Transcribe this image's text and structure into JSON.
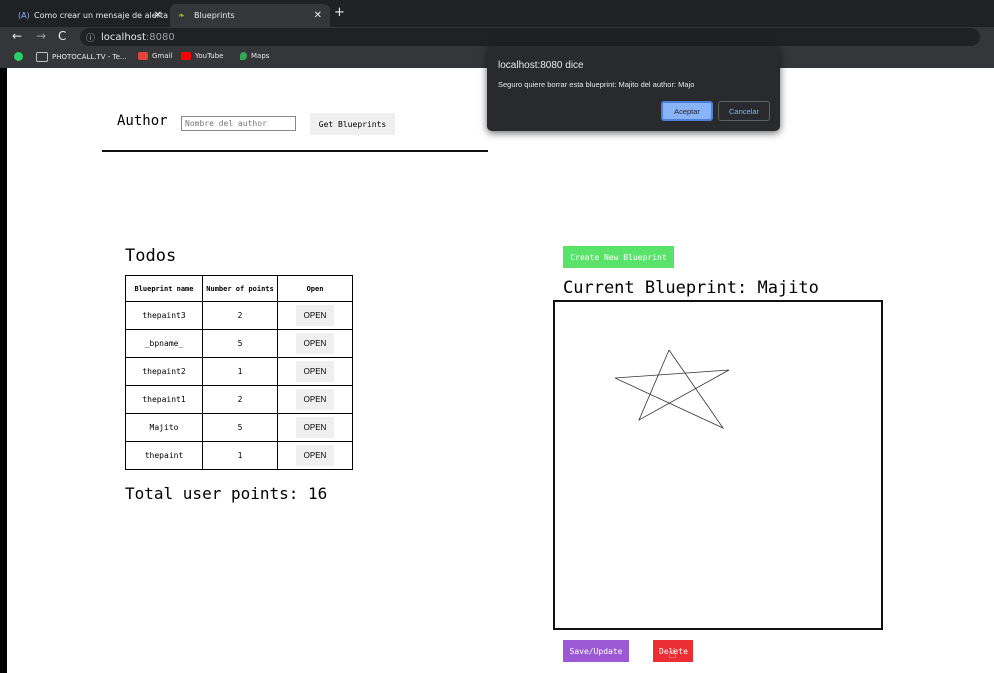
{
  "browser": {
    "tabs": [
      {
        "label": "Como crear un mensaje de alerta",
        "favicon": "(A)",
        "active": false
      },
      {
        "label": "Blueprints",
        "favicon": "leaf",
        "active": true
      }
    ],
    "url_host": "localhost",
    "url_port": ":8080",
    "bookmarks": [
      "PHOTOCALL.TV - Te...",
      "Gmail",
      "YouTube",
      "Maps"
    ]
  },
  "header": {
    "author_label": "Author",
    "author_placeholder": "Nombre del author",
    "get_button": "Get Blueprints"
  },
  "list": {
    "title": "Todos",
    "columns": [
      "Blueprint name",
      "Number of points",
      "Open"
    ],
    "rows": [
      {
        "name": "thepaint3",
        "points": "2",
        "action": "OPEN"
      },
      {
        "name": "_bpname_",
        "points": "5",
        "action": "OPEN"
      },
      {
        "name": "thepaint2",
        "points": "1",
        "action": "OPEN"
      },
      {
        "name": "thepaint1",
        "points": "2",
        "action": "OPEN"
      },
      {
        "name": "Majito",
        "points": "5",
        "action": "OPEN"
      },
      {
        "name": "thepaint",
        "points": "1",
        "action": "OPEN"
      }
    ],
    "total_text": "Total user points: 16"
  },
  "blueprint": {
    "create_button": "Create New Blueprint",
    "current_label": "Current Blueprint:",
    "current_name": "Majito",
    "save_button": "Save/Update",
    "delete_button": "Delete"
  },
  "dialog": {
    "title": "localhost:8080 dice",
    "message": "Seguro quiere borrar esta blueprint: Majito del author: Majo",
    "ok_button": "Aceptar",
    "cancel_button": "Cancelar"
  },
  "colors": {
    "create": "#5ae36a",
    "save": "#9b59d6",
    "delete": "#ec2d35",
    "dialog_ok": "#8ab4f8"
  }
}
